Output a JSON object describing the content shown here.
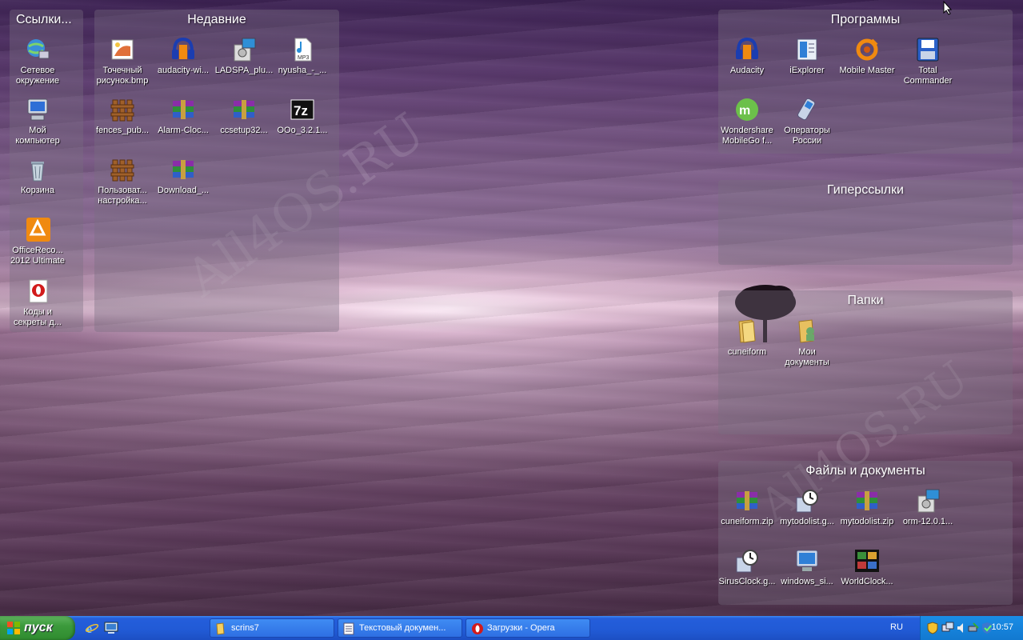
{
  "fences": {
    "links": {
      "title": "Ссылки...",
      "icons": [
        {
          "label": "Сетевое\nокружение",
          "icon": "network-icon"
        },
        {
          "label": "Мой\nкомпьютер",
          "icon": "computer-icon"
        },
        {
          "label": "Корзина",
          "icon": "recycle-bin-icon"
        },
        {
          "label": "OfficeReco...\n2012 Ultimate",
          "icon": "office-recovery-icon"
        },
        {
          "label": "Коды и\nсекреты д...",
          "icon": "opera-icon"
        }
      ]
    },
    "recent": {
      "title": "Недавние",
      "icons": [
        {
          "label": "Точечный\nрисунок.bmp",
          "icon": "bitmap-icon"
        },
        {
          "label": "audacity-wi...",
          "icon": "audacity-icon"
        },
        {
          "label": "LADSPA_plu...",
          "icon": "installer-icon"
        },
        {
          "label": "nyusha_-_...",
          "icon": "mp3-file-icon"
        },
        {
          "label": "fences_pub...",
          "icon": "fences-icon"
        },
        {
          "label": "Alarm-Cloc...",
          "icon": "winrar-icon"
        },
        {
          "label": "ccsetup32...",
          "icon": "winrar-icon"
        },
        {
          "label": "OOo_3.2.1...",
          "icon": "7zip-icon"
        },
        {
          "label": "Пользоват...\nнастройка...",
          "icon": "fences-icon"
        },
        {
          "label": "Download_...",
          "icon": "winrar-icon"
        }
      ]
    },
    "programs": {
      "title": "Программы",
      "icons": [
        {
          "label": "Audacity",
          "icon": "audacity-icon"
        },
        {
          "label": "iExplorer",
          "icon": "iexplorer-icon"
        },
        {
          "label": "Mobile Master",
          "icon": "mobile-master-icon"
        },
        {
          "label": "Total\nCommander",
          "icon": "total-commander-icon"
        },
        {
          "label": "Wondershare\nMobileGo f...",
          "icon": "mobilego-icon"
        },
        {
          "label": "Операторы\nРоссии",
          "icon": "phone-icon"
        }
      ]
    },
    "hyperlinks": {
      "title": "Гиперссылки"
    },
    "folders": {
      "title": "Папки",
      "icons": [
        {
          "label": "cuneiform",
          "icon": "folder-icon"
        },
        {
          "label": "Мои\nдокументы",
          "icon": "my-documents-icon"
        }
      ]
    },
    "files": {
      "title": "Файлы и документы",
      "icons": [
        {
          "label": "cuneiform.zip",
          "icon": "winrar-icon"
        },
        {
          "label": "mytodolist.g...",
          "icon": "clock-app-icon"
        },
        {
          "label": "mytodolist.zip",
          "icon": "winrar-icon"
        },
        {
          "label": "orm-12.0.1...",
          "icon": "installer-icon"
        },
        {
          "label": "SirusClock.g...",
          "icon": "clock-app-icon"
        },
        {
          "label": "windows_si...",
          "icon": "windows-app-icon"
        },
        {
          "label": "WorldClock...",
          "icon": "world-clock-icon"
        }
      ]
    }
  },
  "watermarks": [
    "All4OS.RU",
    "All4OS.RU",
    "All4OS.RU"
  ],
  "taskbar": {
    "start_label": "пуск",
    "quick_launch": [
      "ie-icon",
      "show-desktop-icon"
    ],
    "tasks": [
      {
        "label": "scrins7",
        "icon": "folder-icon"
      },
      {
        "label": "Текстовый докумен...",
        "icon": "notepad-icon"
      },
      {
        "label": "Загрузки - Opera",
        "icon": "opera-icon"
      }
    ],
    "language": "RU",
    "clock": "10:57"
  },
  "colors": {
    "taskbar": "#245edb",
    "start": "#3c9a3c",
    "tray": "#1279d0"
  }
}
